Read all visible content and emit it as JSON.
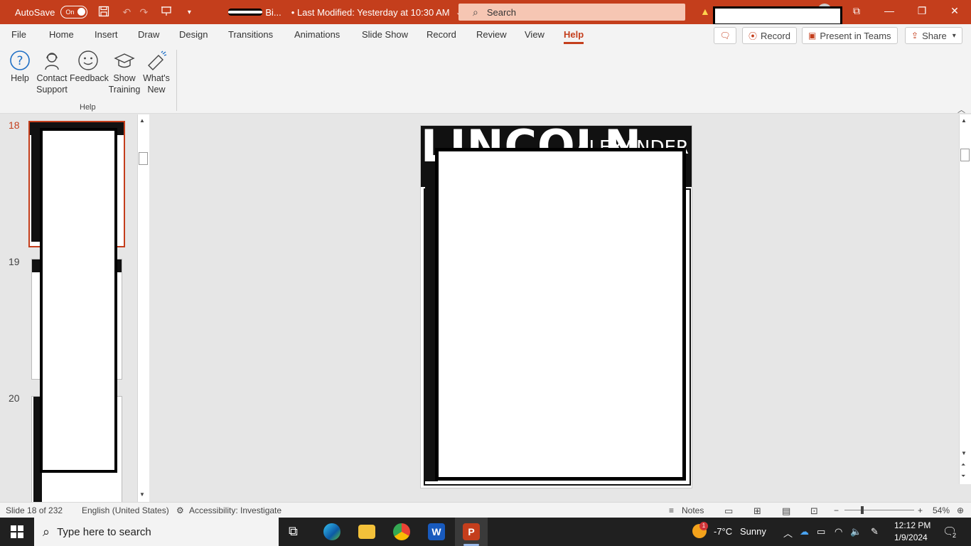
{
  "titlebar": {
    "autosave_label": "AutoSave",
    "autosave_state": "On",
    "doc_name": "Bi...",
    "last_modified": "• Last Modified: Yesterday at 10:30 AM",
    "search_placeholder": "Search"
  },
  "menu": {
    "items": [
      "File",
      "Home",
      "Insert",
      "Draw",
      "Design",
      "Transitions",
      "Animations",
      "Slide Show",
      "Record",
      "Review",
      "View",
      "Help"
    ],
    "active": "Help",
    "record_btn": "Record",
    "teams_btn": "Present in Teams",
    "share_btn": "Share"
  },
  "ribbon": {
    "buttons": [
      {
        "line1": "Help",
        "line2": ""
      },
      {
        "line1": "Contact",
        "line2": "Support"
      },
      {
        "line1": "Feedback",
        "line2": ""
      },
      {
        "line1": "Show",
        "line2": "Training"
      },
      {
        "line1": "What's",
        "line2": "New"
      }
    ],
    "group_label": "Help"
  },
  "thumbnails": {
    "slide_numbers": [
      "18",
      "19",
      "20"
    ],
    "active": "18"
  },
  "slide": {
    "title_big": "LINCOLN",
    "title_small": "ALEXANDER"
  },
  "statusbar": {
    "slide_info": "Slide 18 of 232",
    "language": "English (United States)",
    "accessibility": "Accessibility: Investigate",
    "notes": "Notes",
    "zoom": "54%"
  },
  "taskbar": {
    "search_placeholder": "Type here to search",
    "weather_temp": "-7°C",
    "weather_text": "Sunny",
    "weather_badge": "1",
    "time": "12:12 PM",
    "date": "1/9/2024",
    "notif_count": "2"
  },
  "colors": {
    "accent": "#c43e1c",
    "search_bg": "#f6c6b3",
    "taskbar": "#202020"
  }
}
